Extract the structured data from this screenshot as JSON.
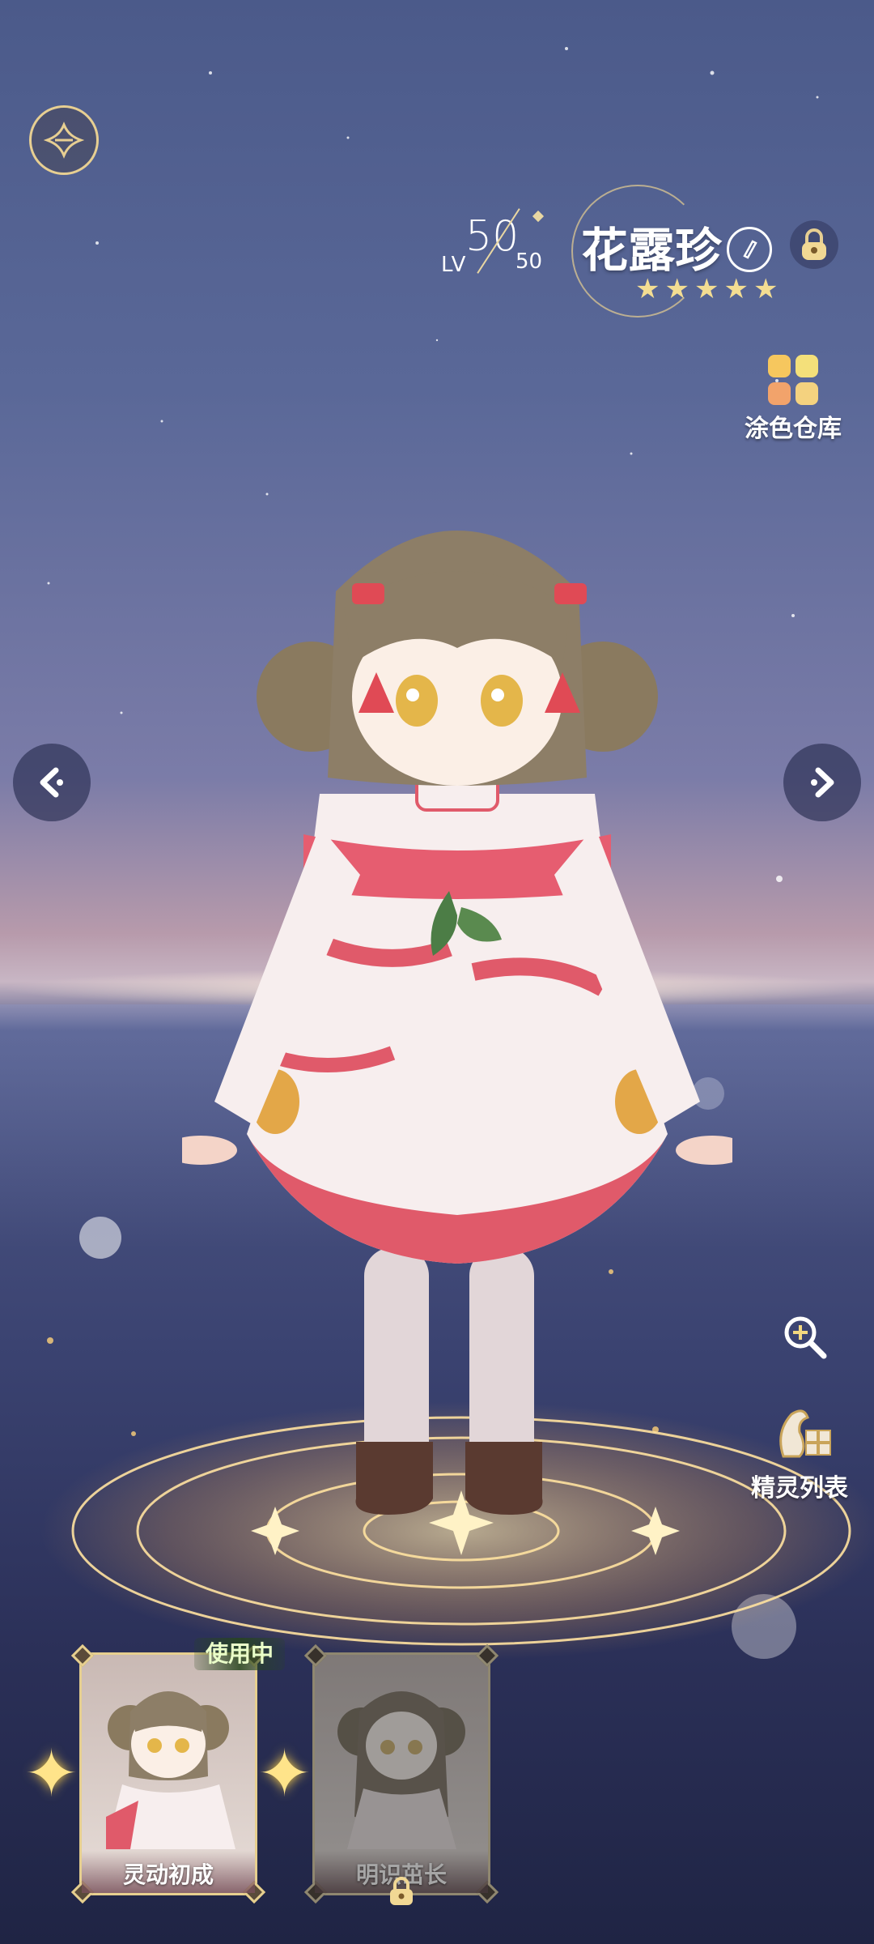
{
  "character": {
    "level_label": "LV",
    "level_current": "50",
    "level_max": "50",
    "name": "花露珍",
    "star_count": 5
  },
  "buttons": {
    "paint_warehouse": "涂色仓库",
    "spirit_list": "精灵列表"
  },
  "outfits": [
    {
      "label": "灵动初成",
      "status": "使用中",
      "locked": false
    },
    {
      "label": "明识茁长",
      "locked": true
    }
  ],
  "colors": {
    "gold": "#e7cf92",
    "star": "#f3dd92",
    "paint_squares": [
      "#f6c75e",
      "#f4e07a",
      "#f2a36b",
      "#f4d27f"
    ]
  },
  "icons": {
    "back": "winged-emblem-icon",
    "edit": "pencil-icon",
    "lock": "lock-icon",
    "zoom": "magnifier-plus-icon",
    "prev": "chevron-left-icon",
    "next": "chevron-right-icon"
  }
}
